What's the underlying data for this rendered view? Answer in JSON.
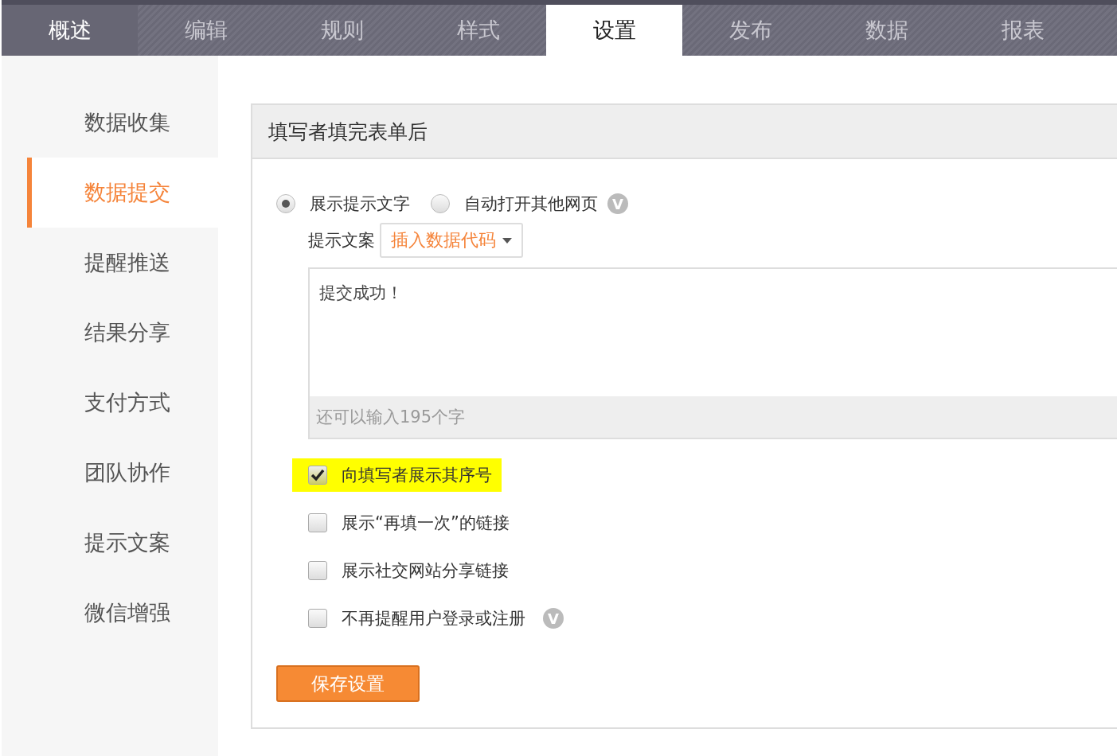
{
  "tabs": [
    {
      "label": "概述",
      "selected": false,
      "hover": true
    },
    {
      "label": "编辑",
      "selected": false,
      "hover": false
    },
    {
      "label": "规则",
      "selected": false,
      "hover": false
    },
    {
      "label": "样式",
      "selected": false,
      "hover": false
    },
    {
      "label": "设置",
      "selected": true,
      "hover": false
    },
    {
      "label": "发布",
      "selected": false,
      "hover": false
    },
    {
      "label": "数据",
      "selected": false,
      "hover": false
    },
    {
      "label": "报表",
      "selected": false,
      "hover": false
    }
  ],
  "sidebar": {
    "items": [
      {
        "label": "数据收集",
        "selected": false
      },
      {
        "label": "数据提交",
        "selected": true
      },
      {
        "label": "提醒推送",
        "selected": false
      },
      {
        "label": "结果分享",
        "selected": false
      },
      {
        "label": "支付方式",
        "selected": false
      },
      {
        "label": "团队协作",
        "selected": false
      },
      {
        "label": "提示文案",
        "selected": false
      },
      {
        "label": "微信增强",
        "selected": false
      }
    ]
  },
  "panel": {
    "title": "填写者填完表单后",
    "radios": [
      {
        "label": "展示提示文字",
        "selected": true
      },
      {
        "label": "自动打开其他网页",
        "selected": false,
        "badge": "V"
      }
    ],
    "message_label": "提示文案",
    "insert_dropdown": "插入数据代码",
    "message": {
      "value": "提交成功！",
      "counter": "还可以输入195个字"
    },
    "options": [
      {
        "label": "向填写者展示其序号",
        "checked": true,
        "highlighted": true
      },
      {
        "label": "展示“再填一次”的链接",
        "checked": false,
        "highlighted": false
      },
      {
        "label": "展示社交网站分享链接",
        "checked": false,
        "highlighted": false
      },
      {
        "label": "不再提醒用户登录或注册",
        "checked": false,
        "highlighted": false,
        "badge": "V"
      }
    ],
    "save_button": "保存设置"
  }
}
